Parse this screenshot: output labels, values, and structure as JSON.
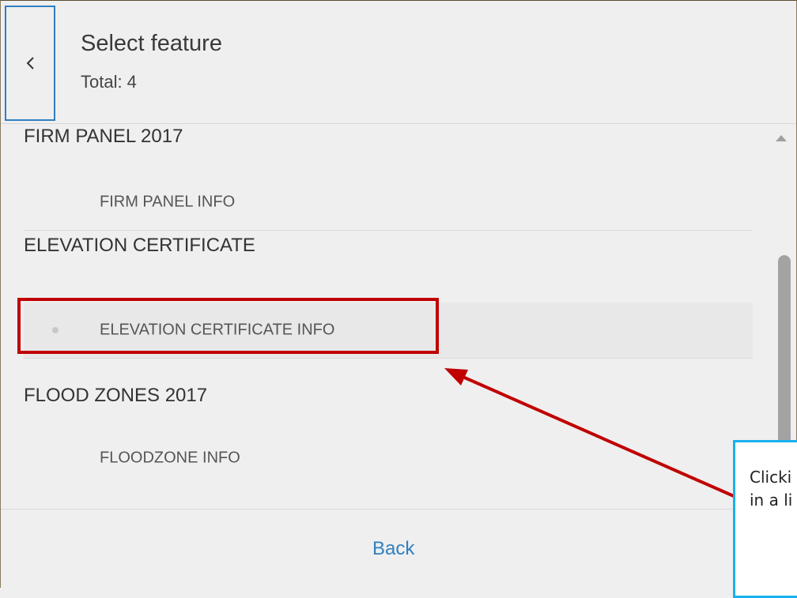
{
  "header": {
    "title": "Select feature",
    "total_label": "Total:",
    "total_value": "4",
    "back_icon": "chevron-left-icon"
  },
  "list": {
    "groups": [
      {
        "title": "FIRM PANEL 2017",
        "items": [
          {
            "label": "FIRM PANEL INFO"
          }
        ]
      },
      {
        "title": "ELEVATION CERTIFICATE",
        "items": [
          {
            "label": "ELEVATION CERTIFICATE INFO",
            "selected": true
          }
        ]
      },
      {
        "title": "FLOOD ZONES 2017",
        "items": [
          {
            "label": "FLOODZONE INFO"
          }
        ]
      }
    ]
  },
  "footer": {
    "back_label": "Back"
  },
  "annotation": {
    "callout_line1": "Clicki",
    "callout_line2": "in a li",
    "highlight_color": "#c00000",
    "callout_border_color": "#1ab0ec"
  },
  "colors": {
    "accent": "#2f7fc1",
    "background": "#efefef"
  }
}
